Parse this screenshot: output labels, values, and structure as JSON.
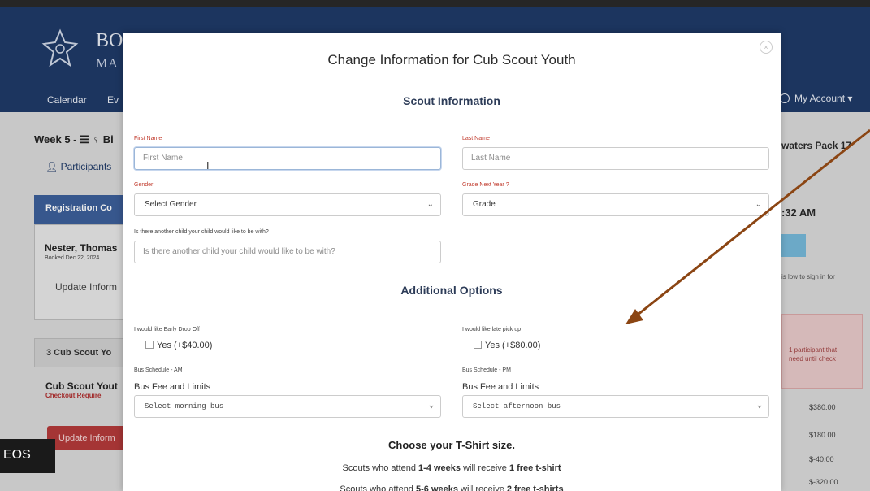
{
  "background": {
    "logo_text": "BO",
    "logo_sub": "MA",
    "nav_calendar": "Calendar",
    "nav_events": "Ev",
    "my_account": "My Account ▾",
    "week_title": "Week 5 - ☰ ♀ Bi",
    "participants": "Participants",
    "registration_tab": "Registration Co",
    "nester_name": "Nester, Thomas",
    "nester_sub": "Booked Dec 22, 2024",
    "update_info": "Update Inform",
    "cub_tab": "3 Cub Scout Yo",
    "cub_title": "Cub Scout Yout",
    "checkout_required": "Checkout Require",
    "update_button": "Update Inform",
    "right_title": "waters Pack 17",
    "right_time": ":32 AM",
    "right_note": "is low to sign in for",
    "right_alert": "1 participant that\nneed until check",
    "prices": [
      "$380.00",
      "$180.00",
      "$-40.00",
      "$-320.00"
    ],
    "videos_badge": "EOS"
  },
  "modal": {
    "title": "Change Information for Cub Scout Youth",
    "close_label": "×",
    "scout_info_heading": "Scout Information",
    "first_name_label": "First Name",
    "first_name_placeholder": "First Name",
    "last_name_label": "Last Name",
    "last_name_placeholder": "Last Name",
    "gender_label": "Gender",
    "gender_value": "Select Gender",
    "grade_label": "Grade Next Year ?",
    "grade_value": "Grade",
    "buddy_label": "Is there another child your child would like to be with?",
    "buddy_placeholder": "Is there another child your child would like to be with?",
    "additional_heading": "Additional Options",
    "early_dropoff_label": "I would like Early Drop Off",
    "early_dropoff_option": "Yes (+$40.00)",
    "late_pickup_label": "I would like late pick up",
    "late_pickup_option": "Yes (+$80.00)",
    "bus_am_label": "Bus Schedule - AM",
    "bus_am_title": "Bus Fee and Limits",
    "bus_am_value": "Select morning bus",
    "bus_pm_label": "Bus Schedule - PM",
    "bus_pm_title": "Bus Fee and Limits",
    "bus_pm_value": "Select afternoon bus",
    "tshirt_heading": "Choose your T-Shirt size.",
    "tshirt_line1_pre": "Scouts who attend ",
    "tshirt_line1_bold1": "1-4 weeks",
    "tshirt_line1_mid": " will receive ",
    "tshirt_line1_bold2": "1 free t-shirt",
    "tshirt_line2_pre": "Scouts who attend ",
    "tshirt_line2_bold1": "5-6 weeks",
    "tshirt_line2_mid": " will receive ",
    "tshirt_line2_bold2": "2 free t-shirts"
  },
  "colors": {
    "header_blue": "#1f3a68",
    "section_heading": "#2d3c58",
    "required_label_red": "#c0392b",
    "annotation_arrow": "#8b4513"
  },
  "icons": {
    "close": "close-icon",
    "chevron": "chevron-down-icon",
    "participant": "person-icon",
    "ibeam": "text-cursor-icon"
  }
}
